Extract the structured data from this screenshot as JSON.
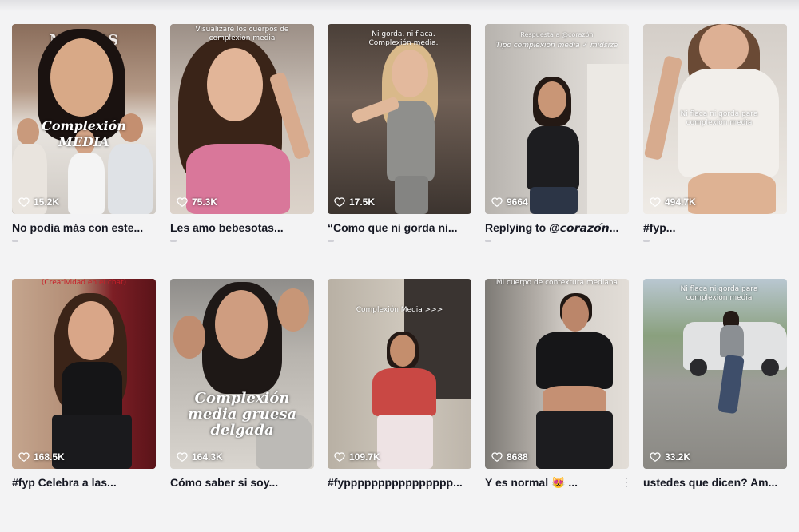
{
  "cards": [
    {
      "likes": "15.2K",
      "caption": "No podía más con este...",
      "overlay": "Complexión MEDIA",
      "overlay_small": "",
      "brand": "MEDIOS"
    },
    {
      "likes": "75.3K",
      "caption": "Les amo bebesotas...",
      "overlay": "Visualizaré los cuerpos de complexión media",
      "overlay_small": ""
    },
    {
      "likes": "17.5K",
      "caption": "“Como que ni gorda ni...",
      "overlay": "Ni gorda, ni flaca. Complexión media.",
      "overlay_small": ""
    },
    {
      "likes": "9664",
      "caption": "Replying to @𝙘𝙤𝙧𝙖𝙯𝙤́𝙣...",
      "overlay": "Tipo complexión media ✓ midsize",
      "overlay_small": "Respuesta a @corazón"
    },
    {
      "likes": "494.7K",
      "caption": "#fyp...",
      "overlay": "Ni flaca ni gorda para complexión media",
      "overlay_small": ""
    },
    {
      "likes": "168.5K",
      "caption": "#fyp Celebra a las...",
      "overlay": "(Creatividad en el chat)",
      "overlay_small": ""
    },
    {
      "likes": "164.3K",
      "caption": "Cómo saber si soy...",
      "overlay": "Complexión media gruesa delgada",
      "overlay_small": ""
    },
    {
      "likes": "109.7K",
      "caption": "#fypppppppppppppppp...",
      "overlay": "Complexión Media >>>",
      "overlay_small": ""
    },
    {
      "likes": "8688",
      "caption": "Y es normal 😻 ...",
      "overlay": "Mi cuerpo de contextura mediana",
      "overlay_small": ""
    },
    {
      "likes": "33.2K",
      "caption": "ustedes que dicen? Am...",
      "overlay": "Ni flaca ni gorda para complexión media",
      "overlay_small": ""
    }
  ],
  "more_label": "⋮",
  "icons": {
    "likes": "heart-outline-icon",
    "more": "more-vertical-icon"
  },
  "colors": {
    "caption": "#161823",
    "background": "#f3f3f4",
    "like_text": "#ffffff"
  }
}
